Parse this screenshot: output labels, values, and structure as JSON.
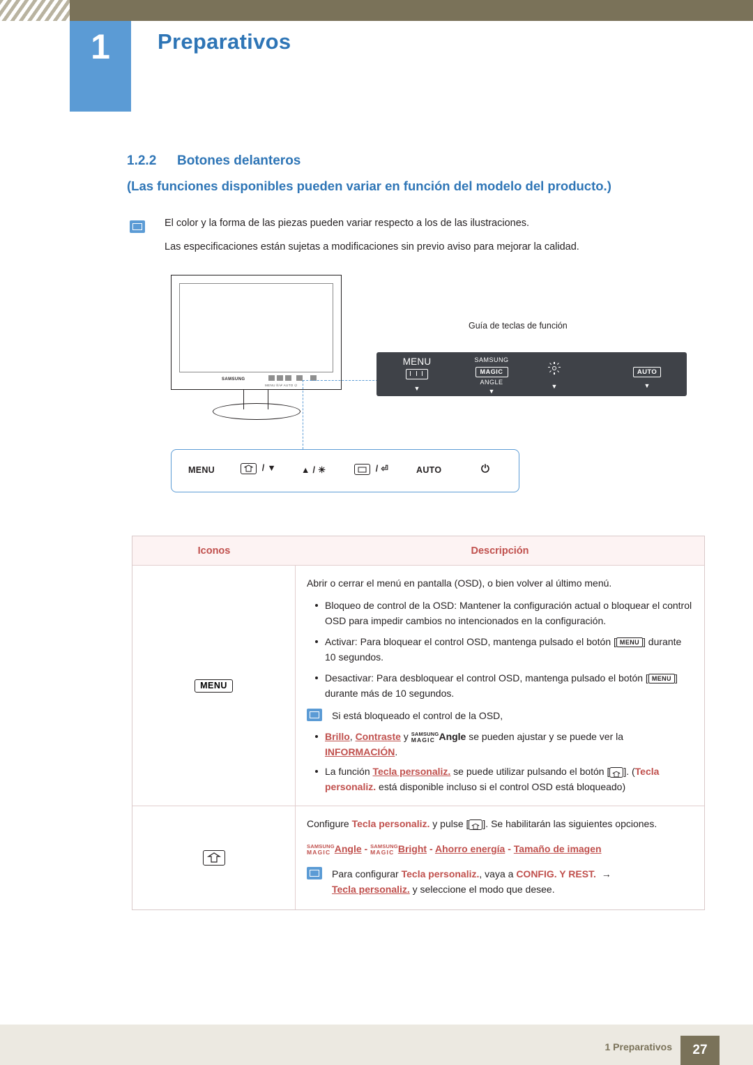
{
  "header": {
    "chapter_number": "1",
    "chapter_title": "Preparativos"
  },
  "section": {
    "number": "1.2.2",
    "title": "Botones delanteros",
    "subtitle": "(Las funciones disponibles pueden variar en función del modelo del producto.)"
  },
  "notes": {
    "note1": "El color y la forma de las piezas pueden variar respecto a los de las ilustraciones.",
    "note2": "Las especificaciones están sujetas a modificaciones sin previo aviso para mejorar la calidad."
  },
  "illustration": {
    "brand_logo": "SAMSUNG",
    "button_strip_labels": "MENU  ⌷/⏎  AUTO  ⏻",
    "guide_caption": "Guía de teclas de función"
  },
  "osd_bar": {
    "items": [
      {
        "label": "MENU",
        "type": "menu-glyph",
        "caret": "▼"
      },
      {
        "label_top": "SAMSUNG",
        "label_box": "MAGIC",
        "label_sub": "ANGLE",
        "type": "magic",
        "caret": "▼"
      },
      {
        "label": "",
        "type": "brightness",
        "caret": "▼"
      },
      {
        "label": "AUTO",
        "type": "box",
        "caret": "▼"
      }
    ]
  },
  "white_bar": {
    "items": [
      {
        "text": "MENU",
        "type": "text"
      },
      {
        "text": "/ ▼",
        "type": "key-down"
      },
      {
        "text": "▲ / ☀",
        "type": "key-up-bright"
      },
      {
        "text": "/ ⏎",
        "type": "key-enter"
      },
      {
        "text": "AUTO",
        "type": "text"
      },
      {
        "text": "⏻",
        "type": "power"
      }
    ]
  },
  "table": {
    "headers": {
      "icons": "Iconos",
      "description": "Descripción"
    },
    "rows": [
      {
        "icon_label": "MENU",
        "icon_type": "menu-cap",
        "intro": "Abrir o cerrar el menú en pantalla (OSD), o bien volver al último menú.",
        "bullets": [
          "Bloqueo de control de la OSD: Mantener la configuración actual o bloquear el control OSD para impedir cambios no intencionados en la configuración.",
          "Activar: Para bloquear el control OSD, mantenga pulsado el botón [MENU] durante 10 segundos.",
          "Desactivar: Para desbloquear el control OSD, mantenga pulsado el botón [MENU] durante más de 10 segundos."
        ],
        "note": "Si está bloqueado el control de la OSD,",
        "note_bullets": [
          {
            "parts": [
              {
                "t": "Brillo",
                "s": "red-u"
              },
              {
                "t": ", ",
                "s": "plain"
              },
              {
                "t": "Contraste",
                "s": "red-u"
              },
              {
                "t": " y ",
                "s": "plain"
              },
              {
                "t": "SAMSUNG MAGIC Angle",
                "s": "magic-inline"
              },
              {
                "t": " se pueden ajustar y se puede ver la ",
                "s": "plain"
              },
              {
                "t": "INFORMACIÓN",
                "s": "red-u"
              },
              {
                "t": ".",
                "s": "plain"
              }
            ]
          },
          {
            "parts": [
              {
                "t": "La función ",
                "s": "plain"
              },
              {
                "t": "Tecla personaliz.",
                "s": "red-u"
              },
              {
                "t": " se puede utilizar pulsando el botón [",
                "s": "plain"
              },
              {
                "t": "KEYCAP",
                "s": "keycap"
              },
              {
                "t": "]. (",
                "s": "plain"
              },
              {
                "t": "Tecla personaliz.",
                "s": "red"
              },
              {
                "t": " está disponible incluso si el control OSD está bloqueado)",
                "s": "plain"
              }
            ]
          }
        ]
      },
      {
        "icon_type": "keycap",
        "icon_label": "",
        "line1_parts": [
          {
            "t": "Configure ",
            "s": "plain"
          },
          {
            "t": "Tecla personaliz.",
            "s": "red"
          },
          {
            "t": " y pulse [",
            "s": "plain"
          },
          {
            "t": "KEYCAP",
            "s": "keycap"
          },
          {
            "t": "]. Se habilitarán las siguientes opciones.",
            "s": "plain"
          }
        ],
        "options_line": [
          {
            "t": "SAMSUNG MAGIC Angle",
            "s": "magic-inline-red"
          },
          {
            "t": " - ",
            "s": "red"
          },
          {
            "t": "SAMSUNG MAGIC Bright",
            "s": "magic-inline-red"
          },
          {
            "t": " - ",
            "s": "red"
          },
          {
            "t": "Ahorro energía",
            "s": "red-u"
          },
          {
            "t": " - ",
            "s": "red"
          },
          {
            "t": "Tamaño de imagen",
            "s": "red-u"
          }
        ],
        "note_parts": [
          {
            "t": "Para configurar ",
            "s": "plain"
          },
          {
            "t": "Tecla personaliz.",
            "s": "red"
          },
          {
            "t": ", vaya a ",
            "s": "plain"
          },
          {
            "t": "CONFIG. Y REST.",
            "s": "red"
          },
          {
            "t": " → ",
            "s": "plain"
          },
          {
            "t": "Tecla personaliz.",
            "s": "red-u"
          },
          {
            "t": " y seleccione el modo que desee.",
            "s": "plain"
          }
        ]
      }
    ]
  },
  "footer": {
    "text": "1 Preparativos",
    "page": "27"
  }
}
